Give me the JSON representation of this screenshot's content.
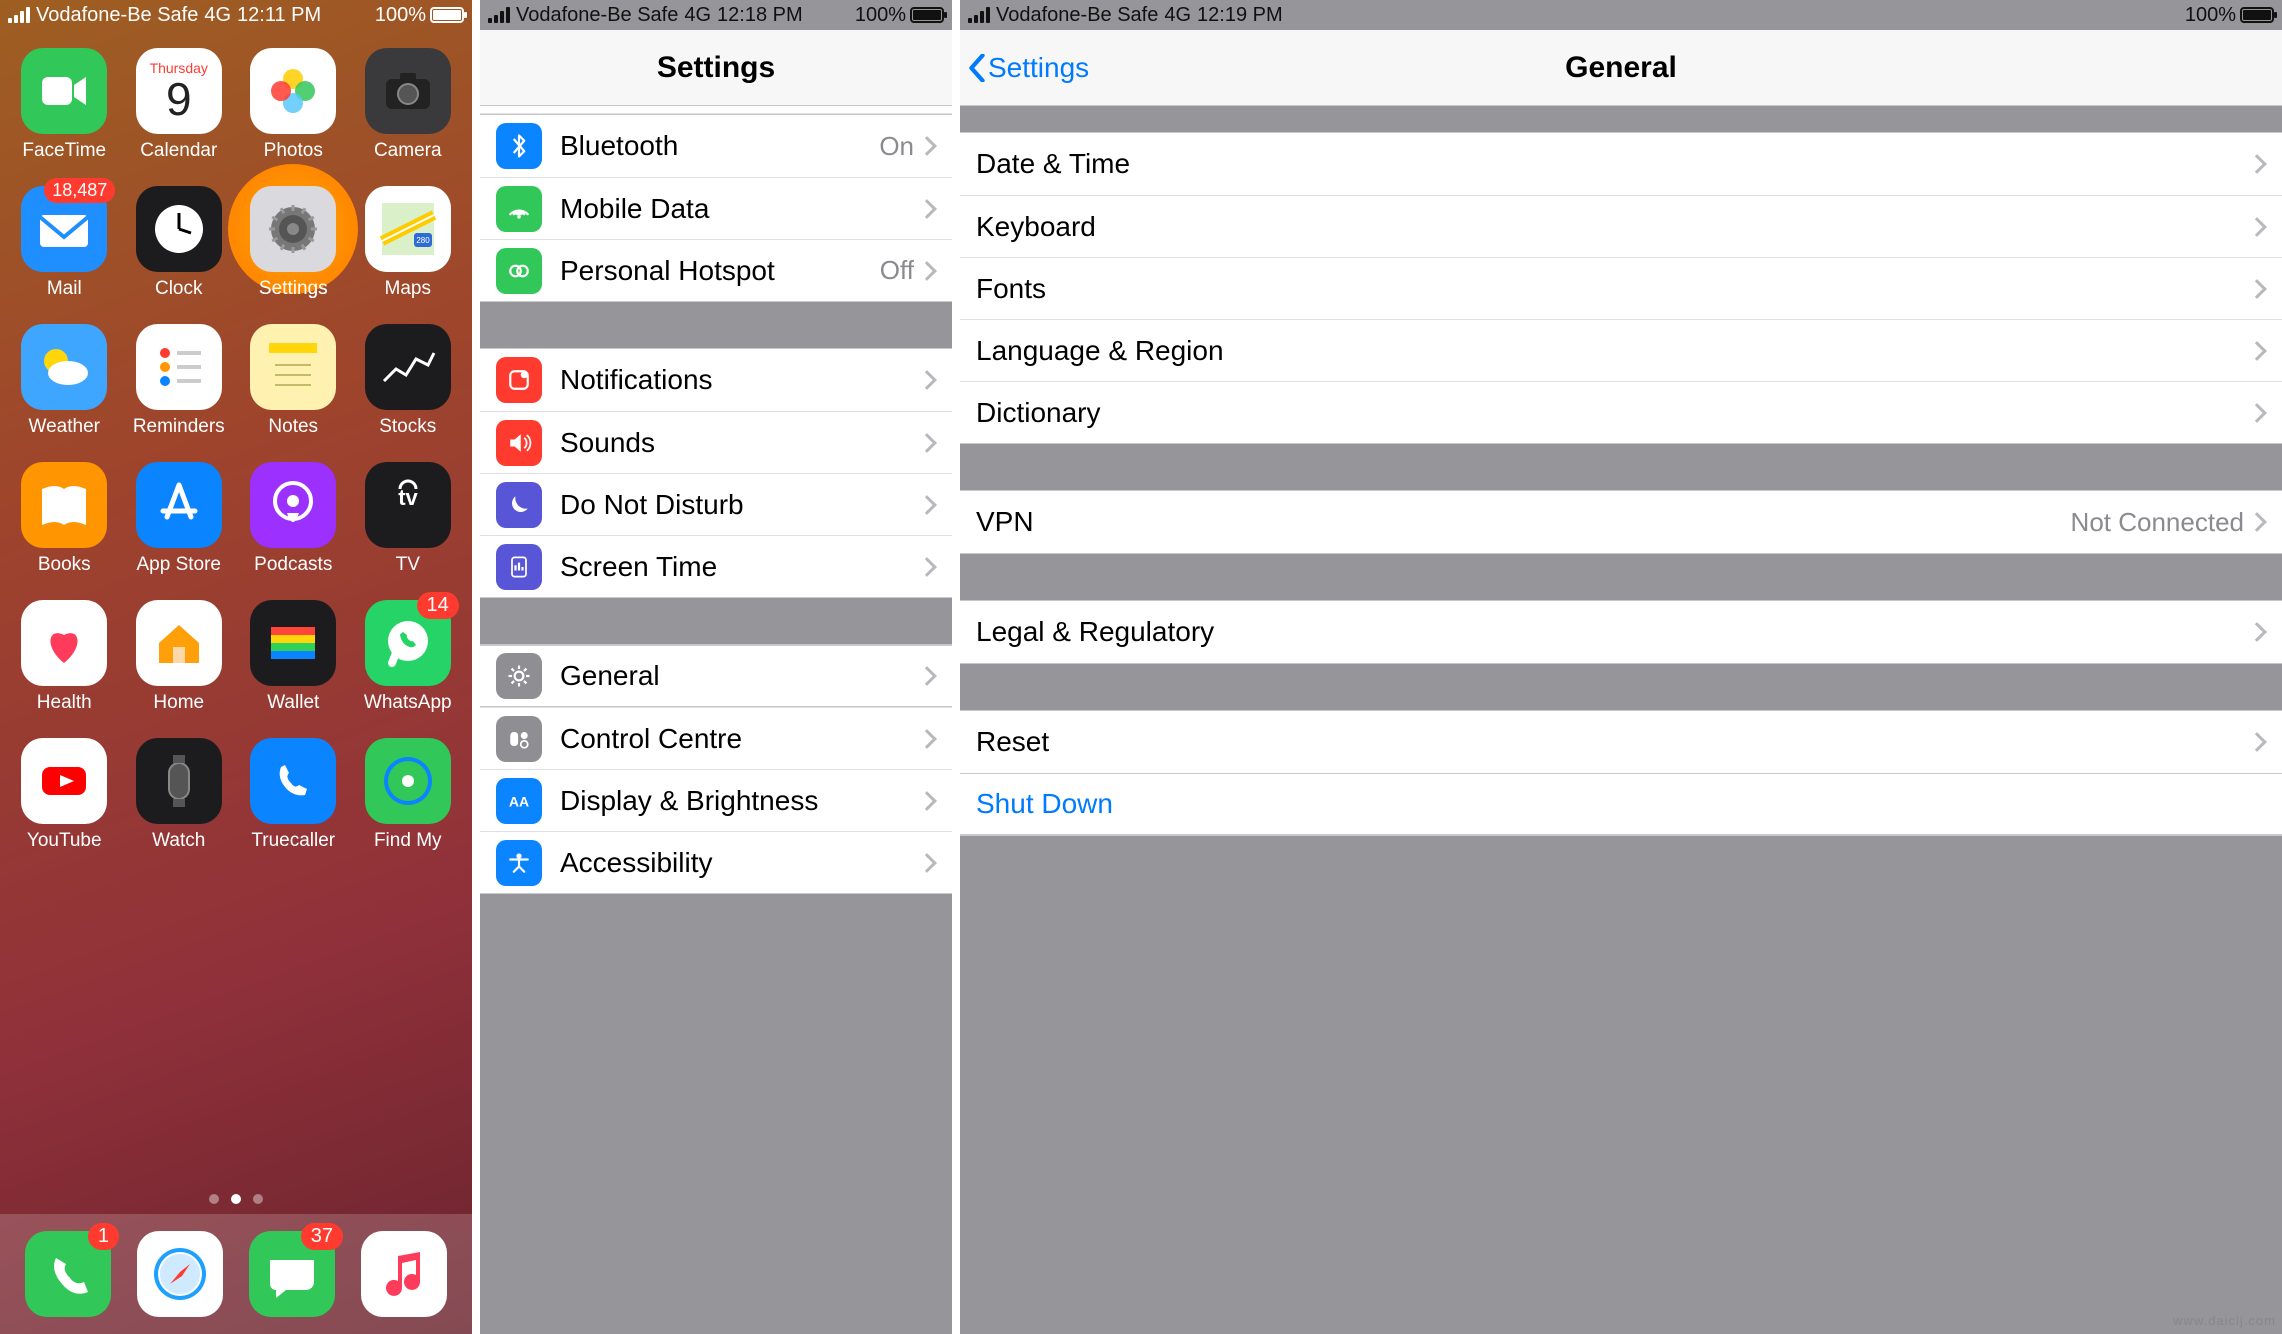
{
  "panel1": {
    "status": {
      "carrier": "Vodafone-Be Safe",
      "network": "4G",
      "time": "12:11 PM",
      "battery": "100%"
    },
    "apps": [
      {
        "name": "FaceTime",
        "bg": "#31c759"
      },
      {
        "name": "Calendar",
        "bg": "#ffffff",
        "day_label": "Thursday",
        "day_num": "9"
      },
      {
        "name": "Photos",
        "bg": "#ffffff"
      },
      {
        "name": "Camera",
        "bg": "#3a3a3c"
      },
      {
        "name": "Mail",
        "bg": "#1f8fff",
        "badge": "18,487"
      },
      {
        "name": "Clock",
        "bg": "#1c1c1e"
      },
      {
        "name": "Settings",
        "bg": "#d9d9de",
        "highlight": true
      },
      {
        "name": "Maps",
        "bg": "#ffffff"
      },
      {
        "name": "Weather",
        "bg": "#3fa6ff"
      },
      {
        "name": "Reminders",
        "bg": "#ffffff"
      },
      {
        "name": "Notes",
        "bg": "#fff2b0"
      },
      {
        "name": "Stocks",
        "bg": "#1c1c1e"
      },
      {
        "name": "Books",
        "bg": "#ff9500"
      },
      {
        "name": "App Store",
        "bg": "#0a84ff"
      },
      {
        "name": "Podcasts",
        "bg": "#9b30ff"
      },
      {
        "name": "TV",
        "bg": "#1c1c1e"
      },
      {
        "name": "Health",
        "bg": "#ffffff"
      },
      {
        "name": "Home",
        "bg": "#ffffff"
      },
      {
        "name": "Wallet",
        "bg": "#1c1c1e"
      },
      {
        "name": "WhatsApp",
        "bg": "#25d366",
        "badge": "14"
      },
      {
        "name": "YouTube",
        "bg": "#ffffff"
      },
      {
        "name": "Watch",
        "bg": "#1c1c1e"
      },
      {
        "name": "Truecaller",
        "bg": "#0a84ff"
      },
      {
        "name": "Find My",
        "bg": "#31c759"
      }
    ],
    "dock": [
      {
        "name": "Phone",
        "bg": "#31c759",
        "badge": "1"
      },
      {
        "name": "Safari",
        "bg": "#ffffff"
      },
      {
        "name": "Messages",
        "bg": "#31c759",
        "badge": "37"
      },
      {
        "name": "Music",
        "bg": "#ffffff"
      }
    ]
  },
  "panel2": {
    "status": {
      "carrier": "Vodafone-Be Safe",
      "network": "4G",
      "time": "12:18 PM",
      "battery": "100%"
    },
    "title": "Settings",
    "group1": [
      {
        "label": "Bluetooth",
        "value": "On",
        "icon_bg": "#0a84ff"
      },
      {
        "label": "Mobile Data",
        "value": "",
        "icon_bg": "#31c759"
      },
      {
        "label": "Personal Hotspot",
        "value": "Off",
        "icon_bg": "#31c759"
      }
    ],
    "group2": [
      {
        "label": "Notifications",
        "icon_bg": "#ff3b30"
      },
      {
        "label": "Sounds",
        "icon_bg": "#ff3b30"
      },
      {
        "label": "Do Not Disturb",
        "icon_bg": "#5856d6"
      },
      {
        "label": "Screen Time",
        "icon_bg": "#5856d6"
      }
    ],
    "group3": [
      {
        "label": "General",
        "icon_bg": "#8e8e93",
        "highlight": true
      },
      {
        "label": "Control Centre",
        "icon_bg": "#8e8e93"
      },
      {
        "label": "Display & Brightness",
        "icon_bg": "#0a84ff"
      },
      {
        "label": "Accessibility",
        "icon_bg": "#0a84ff"
      }
    ]
  },
  "panel3": {
    "status": {
      "carrier": "Vodafone-Be Safe",
      "network": "4G",
      "time": "12:19 PM",
      "battery": "100%"
    },
    "back": "Settings",
    "title": "General",
    "group1": [
      {
        "label": "Date & Time"
      },
      {
        "label": "Keyboard"
      },
      {
        "label": "Fonts"
      },
      {
        "label": "Language & Region"
      },
      {
        "label": "Dictionary"
      }
    ],
    "group2": [
      {
        "label": "VPN",
        "value": "Not Connected"
      }
    ],
    "group3": [
      {
        "label": "Legal & Regulatory"
      }
    ],
    "group4": [
      {
        "label": "Reset"
      },
      {
        "label": "Shut Down",
        "action": true,
        "highlight": true
      }
    ],
    "watermark": "www.daiclj.com"
  }
}
